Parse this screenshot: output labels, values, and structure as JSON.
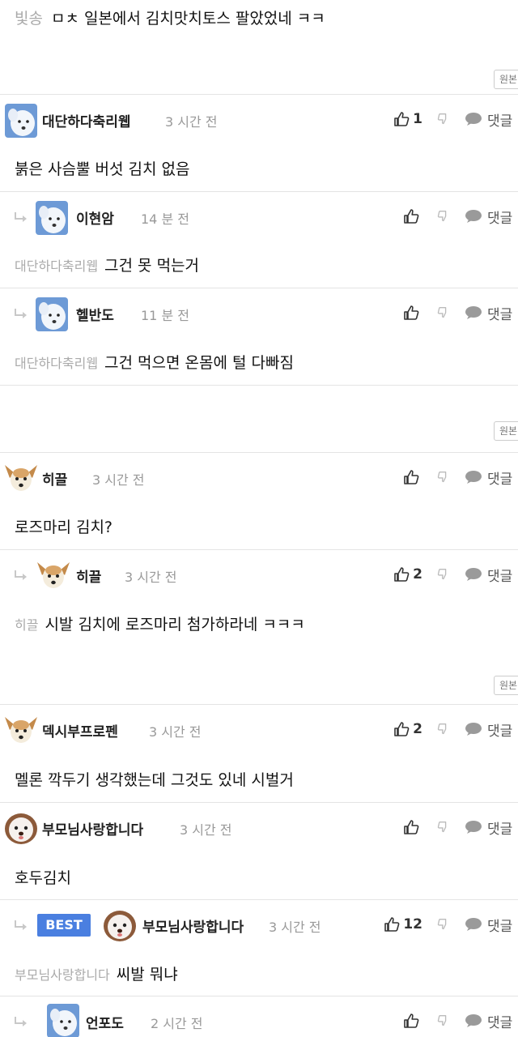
{
  "top_text": {
    "mention": "빛송",
    "body": "ㅁㅊ 일본에서 김치맛치토스 팔았었네 ㅋㅋ"
  },
  "orig_label": "원본",
  "reply_label": "댓글",
  "comments": [
    {
      "nick": "대단하다축리웹",
      "time": "3 시간 전",
      "likes": "1",
      "text": "붉은 사슴뿔 버섯 김치 없음",
      "mention": ""
    },
    {
      "nick": "이현암",
      "time": "14 분 전",
      "likes": "",
      "text": "그건 못 먹는거",
      "mention": "대단하다축리웹"
    },
    {
      "nick": "헬반도",
      "time": "11 분 전",
      "likes": "",
      "text": "그건 먹으면 온몸에 털 다빠짐",
      "mention": "대단하다축리웹"
    },
    {
      "nick": "히끌",
      "time": "3 시간 전",
      "likes": "",
      "text": "로즈마리 김치?",
      "mention": ""
    },
    {
      "nick": "히끌",
      "time": "3 시간 전",
      "likes": "2",
      "text": "시발 김치에 로즈마리 첨가하라네 ㅋㅋㅋ",
      "mention": "히끌"
    },
    {
      "nick": "덱시부프로펜",
      "time": "3 시간 전",
      "likes": "2",
      "text": "멜론 깍두기 생각했는데 그것도 있네 시벌거",
      "mention": ""
    },
    {
      "nick": "부모님사랑합니다",
      "time": "3 시간 전",
      "likes": "",
      "text": "호두김치",
      "mention": ""
    },
    {
      "nick": "부모님사랑합니다",
      "time": "3 시간 전",
      "likes": "12",
      "text": "씨발 뭐냐",
      "mention": "부모님사랑합니다",
      "badge": "BEST"
    },
    {
      "nick": "언포도",
      "time": "2 시간 전",
      "likes": "",
      "text": "",
      "mention": ""
    }
  ]
}
